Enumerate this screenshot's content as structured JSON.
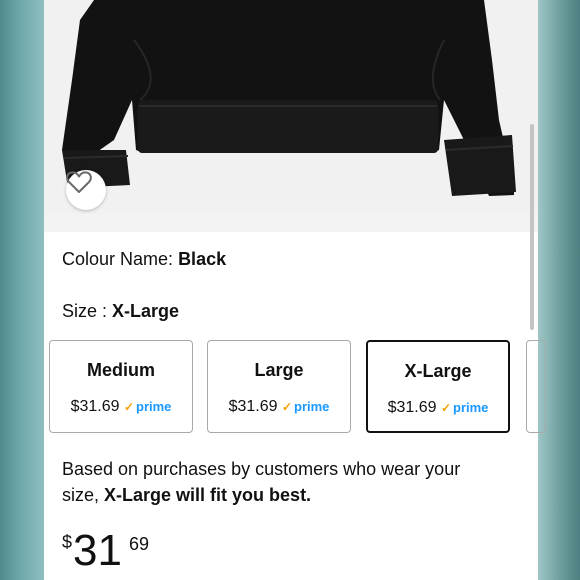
{
  "product": {
    "image_alt": "Black sweatshirt",
    "wishlist_icon": "heart-outline-icon"
  },
  "colour": {
    "label": "Colour Name:",
    "value": "Black"
  },
  "size": {
    "label": "Size :",
    "value": "X-Large",
    "options": [
      {
        "name": "Medium",
        "price": "$31.69",
        "prime": "prime",
        "selected": false
      },
      {
        "name": "Large",
        "price": "$31.69",
        "prime": "prime",
        "selected": false
      },
      {
        "name": "X-Large",
        "price": "$31.69",
        "prime": "prime",
        "selected": true
      }
    ]
  },
  "fit": {
    "text_prefix": "Based on purchases by customers who wear your size,",
    "text_bold": "X-Large will fit you best."
  },
  "price": {
    "currency": "$",
    "whole": "31",
    "fraction": "69"
  },
  "colors": {
    "prime_blue": "#1a98ff",
    "prime_check": "#f7a100",
    "selected_border": "#111111"
  }
}
